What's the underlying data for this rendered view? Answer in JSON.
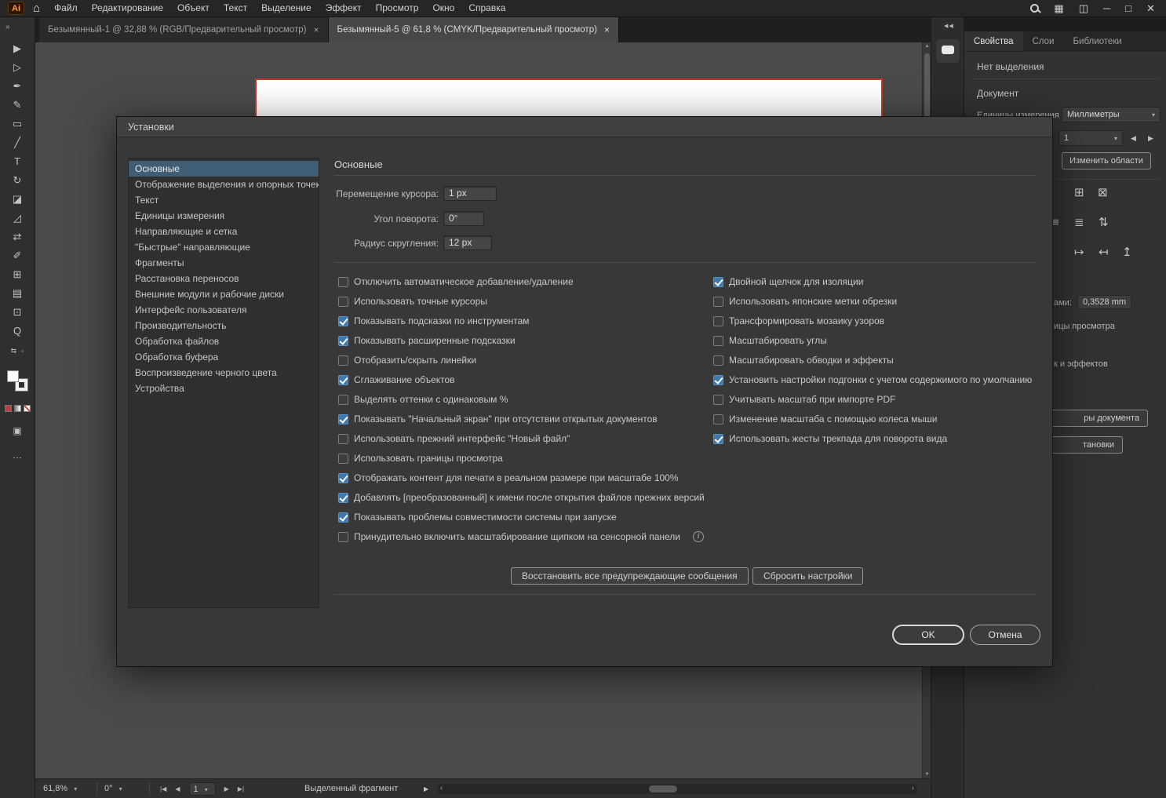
{
  "menubar": {
    "app_icon": "Ai",
    "items": [
      "Файл",
      "Редактирование",
      "Объект",
      "Текст",
      "Выделение",
      "Эффект",
      "Просмотр",
      "Окно",
      "Справка"
    ]
  },
  "icons": {
    "home": "⌂",
    "panel_grid": "▦",
    "panel_columns": "◫",
    "minimize": "─",
    "maximize": "□",
    "close": "✕",
    "tab_close": "×",
    "collapse_right": "»",
    "expand_left": "◀◀",
    "chevron_down": "▾",
    "nav_first": "|◀",
    "nav_prev": "◀",
    "nav_next": "▶",
    "nav_last": "▶|",
    "status_play": "▶",
    "scroll_left": "‹",
    "scroll_right": "›",
    "scroll_up": "▲",
    "scroll_down": "▼",
    "info": "i",
    "prev_arrow": "◀",
    "next_arrow": "▶",
    "grid": "⊞",
    "grid_x": "⊠",
    "lines_a": "≡",
    "lines_b": "≣",
    "swap_vert": "⇅",
    "map_r": "↦",
    "map_l": "↤",
    "map_u": "↥",
    "mini_swap": "⇆",
    "mini_dot": "▫",
    "draw_mode": "▣",
    "more": "…"
  },
  "toolbar": {
    "tools": [
      {
        "name": "selection-tool",
        "glyph": "▶"
      },
      {
        "name": "direct-selection-tool",
        "glyph": "▷"
      },
      {
        "name": "pen-tool",
        "glyph": "✒"
      },
      {
        "name": "curvature-tool",
        "glyph": "✎"
      },
      {
        "name": "rectangle-tool",
        "glyph": "▭"
      },
      {
        "name": "line-tool",
        "glyph": "╱"
      },
      {
        "name": "type-tool",
        "glyph": "T"
      },
      {
        "name": "rotate-tool",
        "glyph": "↻"
      },
      {
        "name": "eraser-tool",
        "glyph": "◪"
      },
      {
        "name": "scale-tool",
        "glyph": "◿"
      },
      {
        "name": "width-tool",
        "glyph": "⇄"
      },
      {
        "name": "eyedropper-tool",
        "glyph": "✐"
      },
      {
        "name": "shape-builder-tool",
        "glyph": "⊞"
      },
      {
        "name": "gradient-tool",
        "glyph": "▤"
      },
      {
        "name": "artboard-tool",
        "glyph": "⊡"
      },
      {
        "name": "zoom-tool",
        "glyph": "Q"
      }
    ]
  },
  "tabs": [
    {
      "label": "Безымянный-1 @ 32,88 % (RGB/Предварительный просмотр)",
      "active": false
    },
    {
      "label": "Безымянный-5 @ 61,8 % (CMYK/Предварительный просмотр)",
      "active": true
    }
  ],
  "dialog": {
    "title": "Установки",
    "section_title": "Основные",
    "sidebar": [
      {
        "label": "Основные",
        "selected": true
      },
      {
        "label": "Отображение выделения и опорных точек",
        "selected": false
      },
      {
        "label": "Текст",
        "selected": false
      },
      {
        "label": "Единицы измерения",
        "selected": false
      },
      {
        "label": "Направляющие и сетка",
        "selected": false
      },
      {
        "label": "\"Быстрые\" направляющие",
        "selected": false
      },
      {
        "label": "Фрагменты",
        "selected": false
      },
      {
        "label": "Расстановка переносов",
        "selected": false
      },
      {
        "label": "Внешние модули и рабочие диски",
        "selected": false
      },
      {
        "label": "Интерфейс пользователя",
        "selected": false
      },
      {
        "label": "Производительность",
        "selected": false
      },
      {
        "label": "Обработка файлов",
        "selected": false
      },
      {
        "label": "Обработка буфера",
        "selected": false
      },
      {
        "label": "Воспроизведение черного цвета",
        "selected": false
      },
      {
        "label": "Устройства",
        "selected": false
      }
    ],
    "fields": [
      {
        "label": "Перемещение курсора:",
        "value": "1 px"
      },
      {
        "label": "Угол поворота:",
        "value": "0°"
      },
      {
        "label": "Радиус скругления:",
        "value": "12 px"
      }
    ],
    "checks_left": [
      {
        "label": "Отключить автоматическое добавление/удаление",
        "checked": false
      },
      {
        "label": "Использовать точные курсоры",
        "checked": false
      },
      {
        "label": "Показывать подсказки по инструментам",
        "checked": true
      },
      {
        "label": "Показывать расширенные подсказки",
        "checked": true
      },
      {
        "label": "Отобразить/скрыть линейки",
        "checked": false
      },
      {
        "label": "Сглаживание объектов",
        "checked": true
      },
      {
        "label": "Выделять оттенки с одинаковым %",
        "checked": false
      },
      {
        "label": "Показывать \"Начальный экран\" при отсутствии открытых документов",
        "checked": true
      },
      {
        "label": "Использовать прежний интерфейс \"Новый файл\"",
        "checked": false
      },
      {
        "label": "Использовать границы просмотра",
        "checked": false
      },
      {
        "label": "Отображать контент для печати в реальном размере при масштабе 100%",
        "checked": true
      },
      {
        "label": "Добавлять [преобразованный] к имени после открытия файлов прежних версий",
        "checked": true
      },
      {
        "label": "Показывать проблемы совместимости системы при запуске",
        "checked": true
      },
      {
        "label": "Принудительно включить масштабирование щипком на сенсорной панели",
        "checked": false
      }
    ],
    "checks_right": [
      {
        "label": "Двойной щелчок для изоляции",
        "checked": true
      },
      {
        "label": "Использовать японские метки обрезки",
        "checked": false
      },
      {
        "label": "Трансформировать мозаику узоров",
        "checked": false
      },
      {
        "label": "Масштабировать углы",
        "checked": false
      },
      {
        "label": "Масштабировать обводки и эффекты",
        "checked": false
      },
      {
        "label": "Установить настройки подгонки с учетом содержимого по умолчанию",
        "checked": true
      },
      {
        "label": "Учитывать масштаб при импорте PDF",
        "checked": false
      },
      {
        "label": "Изменение масштаба с помощью колеса мыши",
        "checked": false
      },
      {
        "label": "Использовать жесты трекпада для поворота вида",
        "checked": true
      }
    ],
    "buttons": {
      "reset_warnings": "Восстановить все предупреждающие сообщения",
      "reset_prefs": "Сбросить настройки",
      "ok": "OK",
      "cancel": "Отмена"
    }
  },
  "right_panel": {
    "tabs": [
      {
        "label": "Свойства",
        "active": true
      },
      {
        "label": "Слои",
        "active": false
      },
      {
        "label": "Библиотеки",
        "active": false
      }
    ],
    "no_selection": "Нет выделения",
    "document_label": "Документ",
    "units_label": "Единицы измерения",
    "units_value": "Миллиметры",
    "artboard_value": "1",
    "edit_artboards": "Изменить области",
    "fragments": {
      "scale_label": "ами:",
      "scale_value": "0,3528 mm",
      "view_units": "ицы просмотра",
      "effects": "к и эффектов",
      "doc_setup": "ры документа",
      "preferences": "тановки"
    }
  },
  "statusbar": {
    "zoom": "61,8%",
    "rotation": "0°",
    "artboard": "1",
    "status": "Выделенный фрагмент"
  }
}
